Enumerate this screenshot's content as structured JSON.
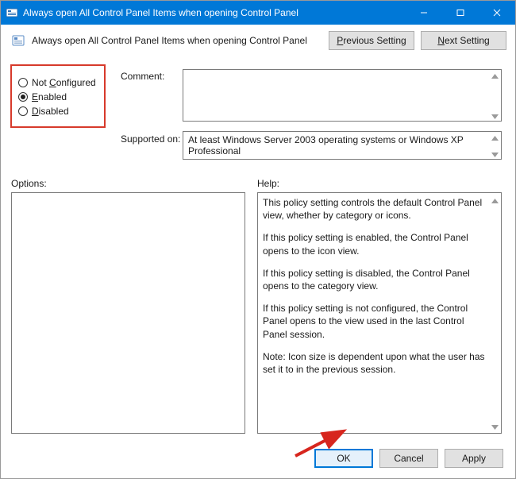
{
  "window": {
    "title": "Always open All Control Panel Items when opening Control Panel"
  },
  "header": {
    "text": "Always open All Control Panel Items when opening Control Panel",
    "prev_label_pre": "P",
    "prev_label_rest": "revious Setting",
    "next_label_pre": "N",
    "next_label_rest": "ext Setting"
  },
  "radios": {
    "not_configured_pre": "Not ",
    "not_configured_u": "C",
    "not_configured_post": "onfigured",
    "enabled_u": "E",
    "enabled_post": "nabled",
    "disabled_u": "D",
    "disabled_post": "isabled",
    "selected": "enabled"
  },
  "labels": {
    "comment": "Comment:",
    "supported": "Supported on:",
    "options": "Options:",
    "help": "Help:"
  },
  "comment_value": "",
  "supported_value": "At least Windows Server 2003 operating systems or Windows XP Professional",
  "help": {
    "p1": "This policy setting controls the default Control Panel view, whether by category or icons.",
    "p2": "If this policy setting is enabled, the Control Panel opens to the icon view.",
    "p3": "If this policy setting is disabled, the Control Panel opens to the category view.",
    "p4": "If this policy setting is not configured, the Control Panel opens to the view used in the last Control Panel session.",
    "p5": "Note: Icon size is dependent upon what the user has set it to in the previous session."
  },
  "buttons": {
    "ok": "OK",
    "cancel": "Cancel",
    "apply": "Apply"
  }
}
